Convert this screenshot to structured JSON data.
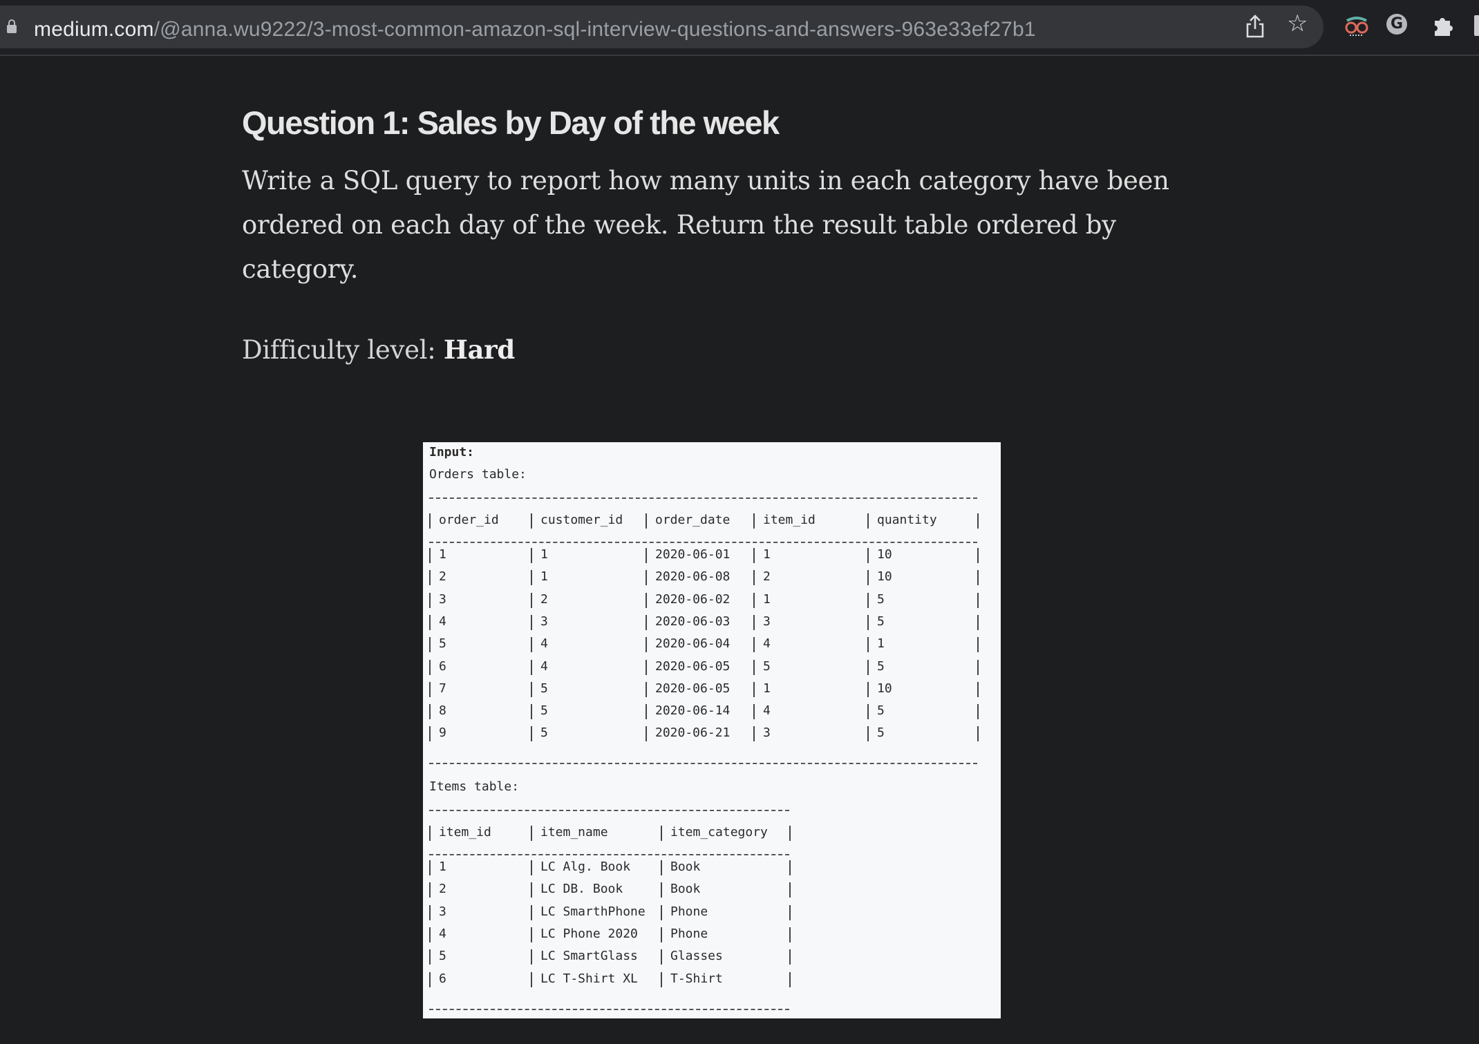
{
  "browser": {
    "url_host": "medium.com",
    "url_path": "/@anna.wu9222/3-most-common-amazon-sql-interview-questions-and-answers-963e33ef27b1",
    "toolbar_icons": [
      "lock-icon",
      "share-icon",
      "star-icon",
      "extension-glasses-icon",
      "grammarly-icon",
      "puzzle-icon"
    ],
    "grammarly_letter": "G"
  },
  "article": {
    "title": "Question 1: Sales by Day of the week",
    "body": "Write a SQL query to report how many units in each category have been ordered on each day of the week. Return the result table ordered by category.",
    "difficulty_label": "Difficulty level: ",
    "difficulty_value": "Hard"
  },
  "figure": {
    "input_label": "Input:",
    "orders_label": "Orders table:",
    "orders_headers": [
      "order_id",
      "customer_id",
      "order_date",
      "item_id",
      "quantity"
    ],
    "orders_rows": [
      [
        "1",
        "1",
        "2020-06-01",
        "1",
        "10"
      ],
      [
        "2",
        "1",
        "2020-06-08",
        "2",
        "10"
      ],
      [
        "3",
        "2",
        "2020-06-02",
        "1",
        "5"
      ],
      [
        "4",
        "3",
        "2020-06-03",
        "3",
        "5"
      ],
      [
        "5",
        "4",
        "2020-06-04",
        "4",
        "1"
      ],
      [
        "6",
        "4",
        "2020-06-05",
        "5",
        "5"
      ],
      [
        "7",
        "5",
        "2020-06-05",
        "1",
        "10"
      ],
      [
        "8",
        "5",
        "2020-06-14",
        "4",
        "5"
      ],
      [
        "9",
        "5",
        "2020-06-21",
        "3",
        "5"
      ]
    ],
    "items_label": "Items table:",
    "items_headers": [
      "item_id",
      "item_name",
      "item_category"
    ],
    "items_rows": [
      [
        "1",
        "LC Alg. Book",
        "Book"
      ],
      [
        "2",
        "LC DB. Book",
        "Book"
      ],
      [
        "3",
        "LC SmarthPhone",
        "Phone"
      ],
      [
        "4",
        "LC Phone 2020",
        "Phone"
      ],
      [
        "5",
        "LC SmartGlass",
        "Glasses"
      ],
      [
        "6",
        "LC T-Shirt XL",
        "T-Shirt"
      ]
    ]
  }
}
